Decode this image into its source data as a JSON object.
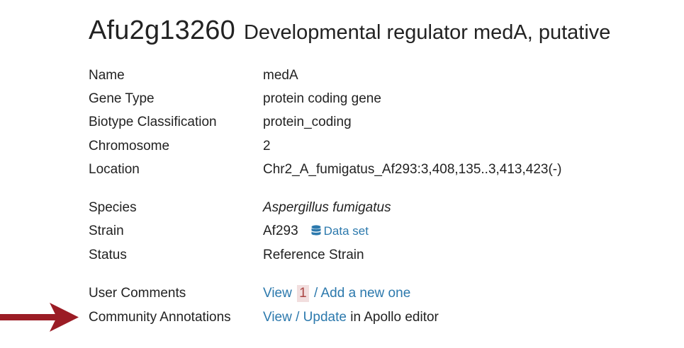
{
  "heading": {
    "gene_id": "Afu2g13260",
    "description": "Developmental regulator medA, putative"
  },
  "fields": {
    "name": {
      "label": "Name",
      "value": "medA"
    },
    "gene_type": {
      "label": "Gene Type",
      "value": "protein coding gene"
    },
    "biotype": {
      "label": "Biotype Classification",
      "value": "protein_coding"
    },
    "chromosome": {
      "label": "Chromosome",
      "value": "2"
    },
    "location": {
      "label": "Location",
      "value": "Chr2_A_fumigatus_Af293:3,408,135..3,413,423(-)"
    },
    "species": {
      "label": "Species",
      "value": "Aspergillus fumigatus"
    },
    "strain": {
      "label": "Strain",
      "value": "Af293",
      "dataset_link": "Data set"
    },
    "status": {
      "label": "Status",
      "value": "Reference Strain"
    },
    "user_comments": {
      "label": "User Comments",
      "view_link": "View",
      "count": "1",
      "add_link": "/ Add a new one"
    },
    "community_annotations": {
      "label": "Community Annotations",
      "view_update_link": "View / Update",
      "suffix": " in Apollo editor"
    }
  },
  "colors": {
    "link": "#2c79ad",
    "text": "#222222",
    "arrow": "#9b1c25",
    "badge_bg": "#f2dede"
  },
  "icons": {
    "dataset": "database-icon",
    "pointer": "arrow-right-icon"
  }
}
